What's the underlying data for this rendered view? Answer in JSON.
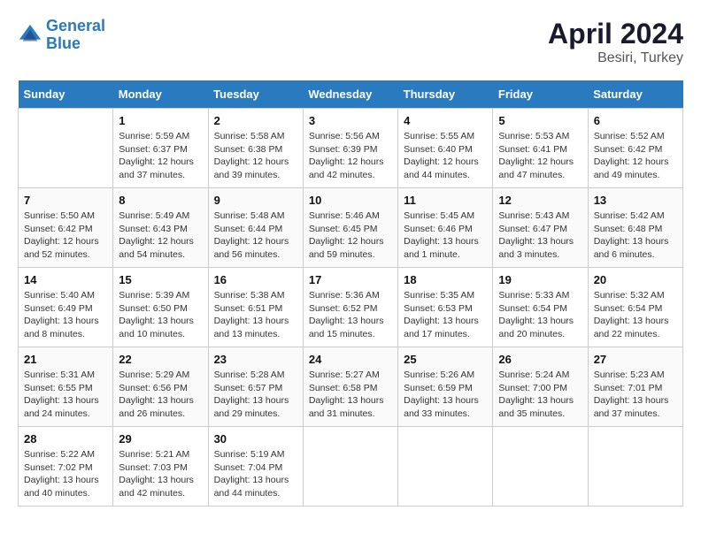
{
  "header": {
    "logo_line1": "General",
    "logo_line2": "Blue",
    "title": "April 2024",
    "location": "Besiri, Turkey"
  },
  "days_of_week": [
    "Sunday",
    "Monday",
    "Tuesday",
    "Wednesday",
    "Thursday",
    "Friday",
    "Saturday"
  ],
  "weeks": [
    [
      {
        "day": "",
        "info": ""
      },
      {
        "day": "1",
        "info": "Sunrise: 5:59 AM\nSunset: 6:37 PM\nDaylight: 12 hours\nand 37 minutes."
      },
      {
        "day": "2",
        "info": "Sunrise: 5:58 AM\nSunset: 6:38 PM\nDaylight: 12 hours\nand 39 minutes."
      },
      {
        "day": "3",
        "info": "Sunrise: 5:56 AM\nSunset: 6:39 PM\nDaylight: 12 hours\nand 42 minutes."
      },
      {
        "day": "4",
        "info": "Sunrise: 5:55 AM\nSunset: 6:40 PM\nDaylight: 12 hours\nand 44 minutes."
      },
      {
        "day": "5",
        "info": "Sunrise: 5:53 AM\nSunset: 6:41 PM\nDaylight: 12 hours\nand 47 minutes."
      },
      {
        "day": "6",
        "info": "Sunrise: 5:52 AM\nSunset: 6:42 PM\nDaylight: 12 hours\nand 49 minutes."
      }
    ],
    [
      {
        "day": "7",
        "info": "Sunrise: 5:50 AM\nSunset: 6:42 PM\nDaylight: 12 hours\nand 52 minutes."
      },
      {
        "day": "8",
        "info": "Sunrise: 5:49 AM\nSunset: 6:43 PM\nDaylight: 12 hours\nand 54 minutes."
      },
      {
        "day": "9",
        "info": "Sunrise: 5:48 AM\nSunset: 6:44 PM\nDaylight: 12 hours\nand 56 minutes."
      },
      {
        "day": "10",
        "info": "Sunrise: 5:46 AM\nSunset: 6:45 PM\nDaylight: 12 hours\nand 59 minutes."
      },
      {
        "day": "11",
        "info": "Sunrise: 5:45 AM\nSunset: 6:46 PM\nDaylight: 13 hours\nand 1 minute."
      },
      {
        "day": "12",
        "info": "Sunrise: 5:43 AM\nSunset: 6:47 PM\nDaylight: 13 hours\nand 3 minutes."
      },
      {
        "day": "13",
        "info": "Sunrise: 5:42 AM\nSunset: 6:48 PM\nDaylight: 13 hours\nand 6 minutes."
      }
    ],
    [
      {
        "day": "14",
        "info": "Sunrise: 5:40 AM\nSunset: 6:49 PM\nDaylight: 13 hours\nand 8 minutes."
      },
      {
        "day": "15",
        "info": "Sunrise: 5:39 AM\nSunset: 6:50 PM\nDaylight: 13 hours\nand 10 minutes."
      },
      {
        "day": "16",
        "info": "Sunrise: 5:38 AM\nSunset: 6:51 PM\nDaylight: 13 hours\nand 13 minutes."
      },
      {
        "day": "17",
        "info": "Sunrise: 5:36 AM\nSunset: 6:52 PM\nDaylight: 13 hours\nand 15 minutes."
      },
      {
        "day": "18",
        "info": "Sunrise: 5:35 AM\nSunset: 6:53 PM\nDaylight: 13 hours\nand 17 minutes."
      },
      {
        "day": "19",
        "info": "Sunrise: 5:33 AM\nSunset: 6:54 PM\nDaylight: 13 hours\nand 20 minutes."
      },
      {
        "day": "20",
        "info": "Sunrise: 5:32 AM\nSunset: 6:54 PM\nDaylight: 13 hours\nand 22 minutes."
      }
    ],
    [
      {
        "day": "21",
        "info": "Sunrise: 5:31 AM\nSunset: 6:55 PM\nDaylight: 13 hours\nand 24 minutes."
      },
      {
        "day": "22",
        "info": "Sunrise: 5:29 AM\nSunset: 6:56 PM\nDaylight: 13 hours\nand 26 minutes."
      },
      {
        "day": "23",
        "info": "Sunrise: 5:28 AM\nSunset: 6:57 PM\nDaylight: 13 hours\nand 29 minutes."
      },
      {
        "day": "24",
        "info": "Sunrise: 5:27 AM\nSunset: 6:58 PM\nDaylight: 13 hours\nand 31 minutes."
      },
      {
        "day": "25",
        "info": "Sunrise: 5:26 AM\nSunset: 6:59 PM\nDaylight: 13 hours\nand 33 minutes."
      },
      {
        "day": "26",
        "info": "Sunrise: 5:24 AM\nSunset: 7:00 PM\nDaylight: 13 hours\nand 35 minutes."
      },
      {
        "day": "27",
        "info": "Sunrise: 5:23 AM\nSunset: 7:01 PM\nDaylight: 13 hours\nand 37 minutes."
      }
    ],
    [
      {
        "day": "28",
        "info": "Sunrise: 5:22 AM\nSunset: 7:02 PM\nDaylight: 13 hours\nand 40 minutes."
      },
      {
        "day": "29",
        "info": "Sunrise: 5:21 AM\nSunset: 7:03 PM\nDaylight: 13 hours\nand 42 minutes."
      },
      {
        "day": "30",
        "info": "Sunrise: 5:19 AM\nSunset: 7:04 PM\nDaylight: 13 hours\nand 44 minutes."
      },
      {
        "day": "",
        "info": ""
      },
      {
        "day": "",
        "info": ""
      },
      {
        "day": "",
        "info": ""
      },
      {
        "day": "",
        "info": ""
      }
    ]
  ]
}
